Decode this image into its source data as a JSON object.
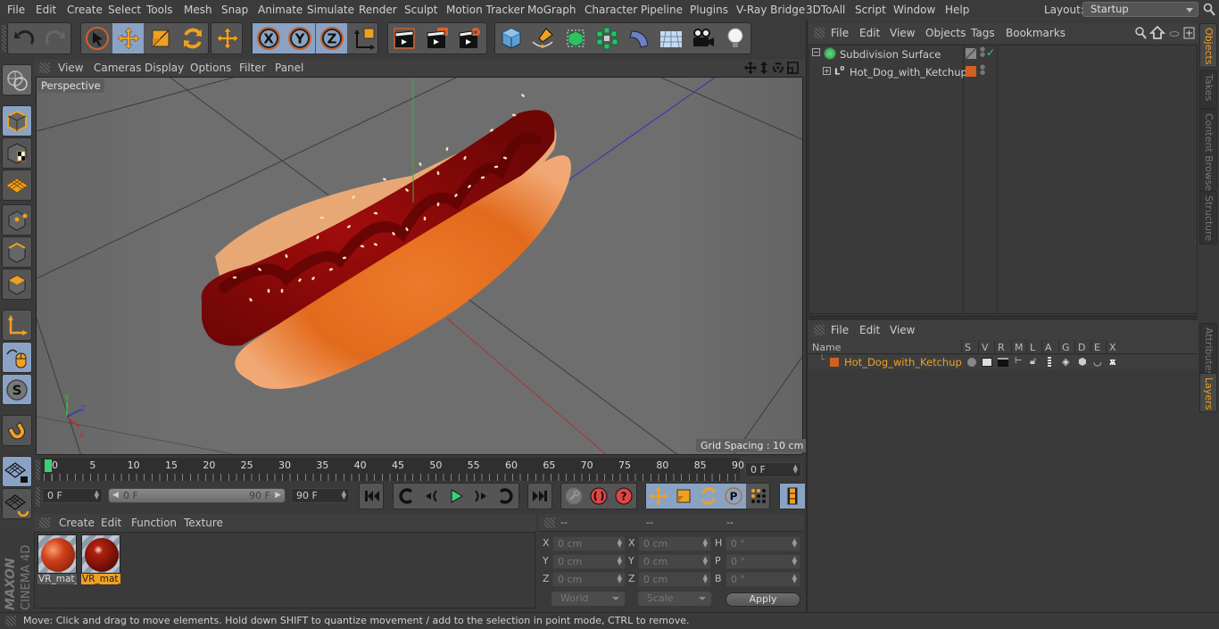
{
  "app": {
    "name": "MAXON CINEMA 4D",
    "brand_line1": "MAXON",
    "brand_line2": "CINEMA 4D"
  },
  "menubar": {
    "items": [
      "File",
      "Edit",
      "Create",
      "Select",
      "Tools",
      "Mesh",
      "Snap",
      "Animate",
      "Simulate",
      "Render",
      "Sculpt",
      "Motion Tracker",
      "MoGraph",
      "Character",
      "Pipeline",
      "Plugins",
      "V-Ray Bridge",
      "3DToAll",
      "Script",
      "Window",
      "Help"
    ],
    "layout_label": "Layout:",
    "layout_value": "Startup"
  },
  "toolbar": {
    "buttons": [
      "undo",
      "redo",
      "live-selection",
      "move",
      "scale",
      "rotate",
      "recent-tool",
      "x-axis",
      "y-axis",
      "z-axis",
      "coordinate-system",
      "render-view",
      "render-picture-viewer",
      "render-settings",
      "cube",
      "pen",
      "subdivision-surface",
      "cloner",
      "deformer",
      "floor",
      "camera",
      "light"
    ],
    "active": [
      "move",
      "x-axis",
      "y-axis",
      "z-axis"
    ]
  },
  "left_palette": {
    "buttons": [
      "make-editable",
      "model-mode",
      "texture-mode",
      "workplane-mode",
      "point-mode",
      "edge-mode",
      "polygon-mode",
      "axis-mode",
      "tweak-mode",
      "solo-mode",
      "snap",
      "locked-workplane",
      "planar-workplane"
    ],
    "active": [
      "model-mode",
      "tweak-mode",
      "solo-mode",
      "locked-workplane"
    ]
  },
  "viewport": {
    "menus": [
      "View",
      "Cameras",
      "Display",
      "Options",
      "Filter",
      "Panel"
    ],
    "camera_label": "Perspective",
    "grid_spacing": "Grid Spacing : 10 cm",
    "axis_labels": {
      "x": "X",
      "y": "Y",
      "z": "Z"
    }
  },
  "timeline": {
    "ticks": [
      "0",
      "5",
      "10",
      "15",
      "20",
      "25",
      "30",
      "35",
      "40",
      "45",
      "50",
      "55",
      "60",
      "65",
      "70",
      "75",
      "80",
      "85",
      "90"
    ],
    "current_frame": "0 F",
    "start_field": "0 F",
    "range_start": "0 F",
    "range_end": "90 F",
    "end_field": "90 F",
    "playhead_frame": 0,
    "max_frame": 90
  },
  "playback": {
    "buttons": [
      "go-to-start",
      "previous-key",
      "previous-frame",
      "play",
      "next-frame",
      "next-key",
      "go-to-end",
      "record-active",
      "autokeying",
      "keyframe-selection",
      "position-key",
      "scale-key",
      "rotation-key",
      "parameter-key",
      "point-level-animation",
      "scheme-menu"
    ]
  },
  "material_manager": {
    "menus": [
      "Create",
      "Edit",
      "Function",
      "Texture"
    ],
    "materials": [
      {
        "name": "VR_mat_",
        "selected": false
      },
      {
        "name": "VR_mat_",
        "selected": true
      }
    ]
  },
  "coordinates": {
    "headers": [
      "--",
      "--",
      "--"
    ],
    "rows": [
      {
        "a_label": "X",
        "a": "0 cm",
        "b_label": "X",
        "b": "0 cm",
        "c_label": "H",
        "c": "0 °"
      },
      {
        "a_label": "Y",
        "a": "0 cm",
        "b_label": "Y",
        "b": "0 cm",
        "c_label": "P",
        "c": "0 °"
      },
      {
        "a_label": "Z",
        "a": "0 cm",
        "b_label": "Z",
        "b": "0 cm",
        "c_label": "B",
        "c": "0 °"
      }
    ],
    "mode_select": "World",
    "size_select": "Scale",
    "apply_label": "Apply"
  },
  "object_manager": {
    "menus": [
      "File",
      "Edit",
      "View",
      "Objects",
      "Tags",
      "Bookmarks"
    ],
    "objects": [
      {
        "name": "Subdivision Surface",
        "icon": "subdivision-surface-icon"
      },
      {
        "name": "Hot_Dog_with_Ketchup",
        "icon": "null-object-icon",
        "layer_color": "#d2601e"
      }
    ]
  },
  "layer_manager": {
    "menus": [
      "File",
      "Edit",
      "View"
    ],
    "columns": [
      "Name",
      "S",
      "V",
      "R",
      "M",
      "L",
      "A",
      "G",
      "D",
      "E",
      "X"
    ],
    "layers": [
      {
        "name": "Hot_Dog_with_Ketchup",
        "color": "#d2601e"
      }
    ]
  },
  "right_tabs": {
    "top": [
      {
        "label": "Objects",
        "active": true
      },
      {
        "label": "Takes",
        "active": false
      },
      {
        "label": "Content Browser",
        "active": false
      },
      {
        "label": "Structure",
        "active": false
      }
    ],
    "bottom": [
      {
        "label": "Attributes",
        "active": false
      },
      {
        "label": "Layers",
        "active": true
      }
    ]
  },
  "status": {
    "text": "Move: Click and drag to move elements. Hold down SHIFT to quantize movement / add to the selection in point mode, CTRL to remove."
  },
  "colors": {
    "accent": "#f0a020",
    "active_button": "#8aa3c4",
    "layer_orange": "#d2601e",
    "playhead": "#3ad07a"
  }
}
